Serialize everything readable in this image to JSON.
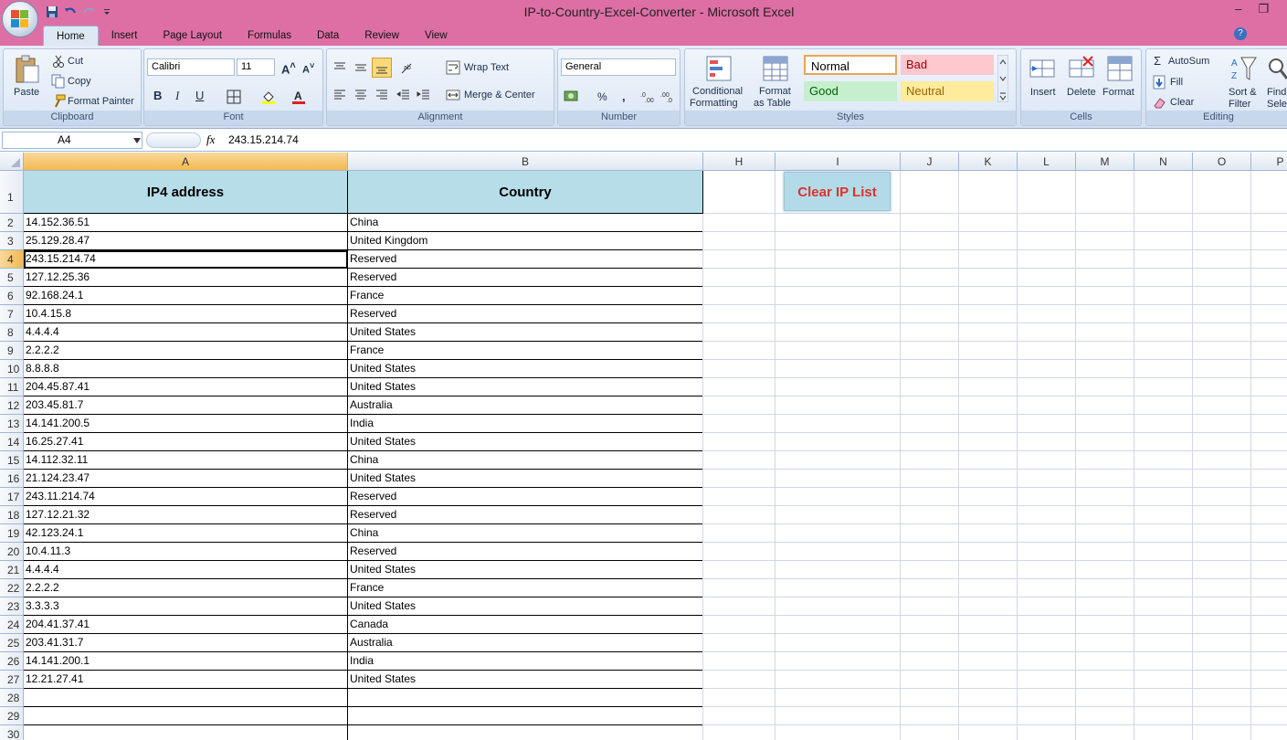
{
  "window": {
    "title": "IP-to-Country-Excel-Converter - Microsoft Excel",
    "tabs": [
      "Home",
      "Insert",
      "Page Layout",
      "Formulas",
      "Data",
      "Review",
      "View"
    ]
  },
  "ribbon": {
    "clipboard": {
      "label": "Clipboard",
      "paste": "Paste",
      "cut": "Cut",
      "copy": "Copy",
      "format_painter": "Format Painter"
    },
    "font": {
      "label": "Font",
      "name": "Calibri",
      "size": "11",
      "bold": "B",
      "italic": "I",
      "underline": "U"
    },
    "alignment": {
      "label": "Alignment",
      "wrap_text": "Wrap Text",
      "merge_center": "Merge & Center"
    },
    "number": {
      "label": "Number",
      "format": "General",
      "percent": "%",
      "comma": ","
    },
    "styles": {
      "label": "Styles",
      "conditional_1": "Conditional",
      "conditional_2": "Formatting",
      "format_table_1": "Format",
      "format_table_2": "as Table",
      "normal": "Normal",
      "bad": "Bad",
      "good": "Good",
      "neutral": "Neutral"
    },
    "cells": {
      "label": "Cells",
      "insert": "Insert",
      "delete": "Delete",
      "format": "Format"
    },
    "editing": {
      "label": "Editing",
      "autosum": "AutoSum",
      "fill": "Fill",
      "clear": "Clear",
      "sort_1": "Sort &",
      "sort_2": "Filter",
      "find_1": "Find",
      "find_2": "Selec"
    }
  },
  "formula_bar": {
    "name_box": "A4",
    "fx": "fx",
    "formula": "243.15.214.74"
  },
  "columns": [
    "A",
    "B",
    "H",
    "I",
    "J",
    "K",
    "L",
    "M",
    "N",
    "O",
    "P"
  ],
  "table": {
    "headers": [
      "IP4 address",
      "Country"
    ],
    "rows": [
      [
        "14.152.36.51",
        "China"
      ],
      [
        "25.129.28.47",
        "United Kingdom"
      ],
      [
        "243.15.214.74",
        "Reserved"
      ],
      [
        "127.12.25.36",
        "Reserved"
      ],
      [
        "92.168.24.1",
        "France"
      ],
      [
        "10.4.15.8",
        "Reserved"
      ],
      [
        "4.4.4.4",
        "United States"
      ],
      [
        "2.2.2.2",
        "France"
      ],
      [
        "8.8.8.8",
        "United States"
      ],
      [
        "204.45.87.41",
        "United States"
      ],
      [
        "203.45.81.7",
        "Australia"
      ],
      [
        "14.141.200.5",
        "India"
      ],
      [
        "16.25.27.41",
        "United States"
      ],
      [
        "14.112.32.11",
        "China"
      ],
      [
        "21.124.23.47",
        "United States"
      ],
      [
        "243.11.214.74",
        "Reserved"
      ],
      [
        "127.12.21.32",
        "Reserved"
      ],
      [
        "42.123.24.1",
        "China"
      ],
      [
        "10.4.11.3",
        "Reserved"
      ],
      [
        "4.4.4.4",
        "United States"
      ],
      [
        "2.2.2.2",
        "France"
      ],
      [
        "3.3.3.3",
        "United States"
      ],
      [
        "204.41.37.41",
        "Canada"
      ],
      [
        "203.41.31.7",
        "Australia"
      ],
      [
        "14.141.200.1",
        "India"
      ],
      [
        "12.21.27.41",
        "United States"
      ]
    ]
  },
  "row_numbers": [
    "1",
    "2",
    "3",
    "4",
    "5",
    "6",
    "7",
    "8",
    "9",
    "10",
    "11",
    "12",
    "13",
    "14",
    "15",
    "16",
    "17",
    "18",
    "19",
    "20",
    "21",
    "22",
    "23",
    "24",
    "25",
    "26",
    "27",
    "28",
    "29",
    "30"
  ],
  "clear_button": "Clear IP List"
}
